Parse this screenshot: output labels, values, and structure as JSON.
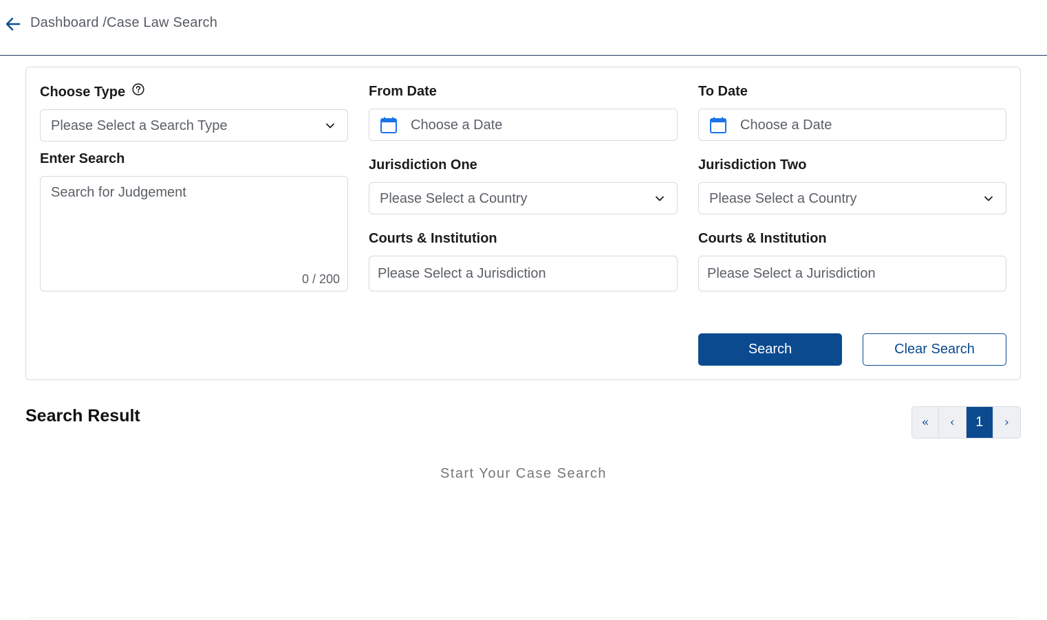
{
  "header": {
    "back_icon": "arrow-left-icon",
    "breadcrumb": "Dashboard /Case Law Search"
  },
  "form": {
    "choose_type": {
      "label": "Choose Type",
      "help_icon": "question-circle-icon",
      "value": "Please Select a Search Type"
    },
    "enter_search": {
      "label": "Enter Search",
      "placeholder": "Search for Judgement",
      "counter": "0 / 200"
    },
    "from_date": {
      "label": "From Date",
      "placeholder": "Choose a Date",
      "icon": "calendar-icon"
    },
    "to_date": {
      "label": "To Date",
      "placeholder": "Choose a Date",
      "icon": "calendar-icon"
    },
    "jurisdiction_one": {
      "label": "Jurisdiction One",
      "value": "Please Select a Country"
    },
    "jurisdiction_two": {
      "label": "Jurisdiction Two",
      "value": "Please Select a Country"
    },
    "courts_one": {
      "label": "Courts & Institution",
      "value": "Please Select a Jurisdiction"
    },
    "courts_two": {
      "label": "Courts & Institution",
      "value": "Please Select a Jurisdiction"
    },
    "search_button": "Search",
    "clear_button": "Clear Search"
  },
  "results": {
    "title": "Search Result",
    "pagination": {
      "first": "«",
      "prev": "‹",
      "current": "1",
      "next": "›"
    },
    "empty_message": "Start Your Case Search"
  },
  "colors": {
    "primary": "#0b4a8f",
    "border": "#d5d9df",
    "calendar": "#1a73e8"
  }
}
